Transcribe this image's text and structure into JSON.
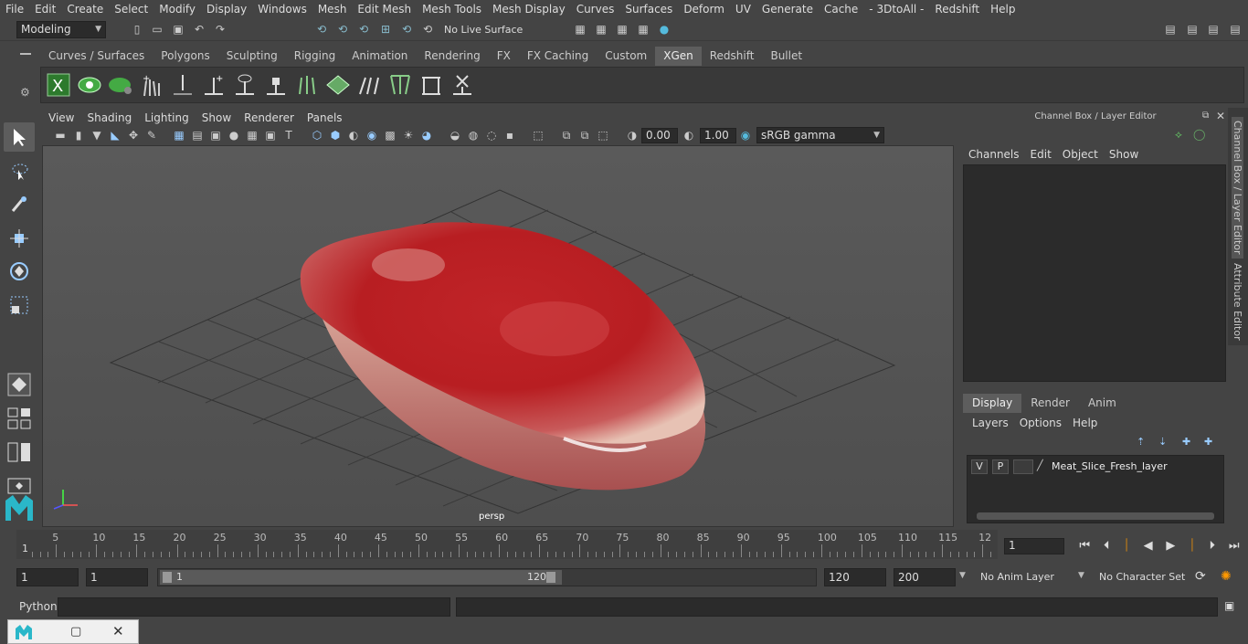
{
  "menubar": {
    "items": [
      "File",
      "Edit",
      "Create",
      "Select",
      "Modify",
      "Display",
      "Windows",
      "Mesh",
      "Edit Mesh",
      "Mesh Tools",
      "Mesh Display",
      "Curves",
      "Surfaces",
      "Deform",
      "UV",
      "Generate",
      "Cache",
      "- 3DtoAll -",
      "Redshift",
      "Help"
    ]
  },
  "statusline": {
    "mode": "Modeling",
    "live_surface": "No Live Surface"
  },
  "shelf": {
    "tabs": [
      "Curves / Surfaces",
      "Polygons",
      "Sculpting",
      "Rigging",
      "Animation",
      "Rendering",
      "FX",
      "FX Caching",
      "Custom",
      "XGen",
      "Redshift",
      "Bullet"
    ],
    "active_tab": "XGen"
  },
  "panel": {
    "menus": [
      "View",
      "Shading",
      "Lighting",
      "Show",
      "Renderer",
      "Panels"
    ],
    "exposure": "0.00",
    "gamma": "1.00",
    "color_space": "sRGB gamma",
    "camera_label": "persp"
  },
  "channel_box": {
    "title": "Channel Box / Layer Editor",
    "menus": [
      "Channels",
      "Edit",
      "Object",
      "Show"
    ],
    "side_tab_1": "Channel Box / Layer Editor",
    "side_tab_2": "Attribute Editor"
  },
  "layer_editor": {
    "tabs": [
      "Display",
      "Render",
      "Anim"
    ],
    "active_tab": "Display",
    "menus": [
      "Layers",
      "Options",
      "Help"
    ],
    "layer": {
      "v": "V",
      "p": "P",
      "name": "Meat_Slice_Fresh_layer"
    }
  },
  "timeline": {
    "ticks": [
      "5",
      "10",
      "15",
      "20",
      "25",
      "30",
      "35",
      "40",
      "45",
      "50",
      "55",
      "60",
      "65",
      "70",
      "75",
      "80",
      "85",
      "90",
      "95",
      "100",
      "105",
      "110",
      "115",
      "12"
    ],
    "start_label": "1",
    "current_frame": "1"
  },
  "range": {
    "start": "1",
    "playback_start": "1",
    "slider_start": "1",
    "slider_end": "120",
    "playback_end": "120",
    "end": "200",
    "anim_layer": "No Anim Layer",
    "character_set": "No Character Set"
  },
  "command": {
    "label": "Python"
  }
}
